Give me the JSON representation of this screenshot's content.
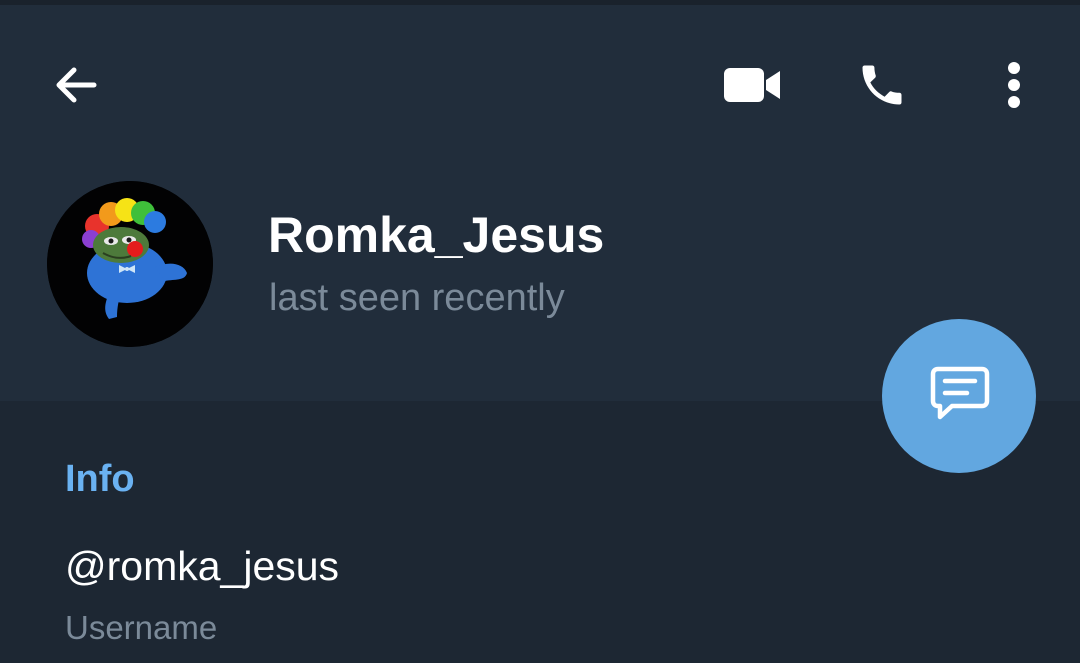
{
  "toolbar": {
    "back_icon": "arrow-left-icon",
    "video_icon": "video-camera-icon",
    "call_icon": "phone-icon",
    "more_icon": "more-vertical-icon"
  },
  "profile": {
    "name": "Romka_Jesus",
    "status": "last seen recently",
    "avatar_icon": "clown-frog-avatar"
  },
  "fab": {
    "icon": "message-bubble-icon"
  },
  "info": {
    "title": "Info",
    "username": "@romka_jesus",
    "username_label": "Username"
  },
  "colors": {
    "header_bg": "#212d3b",
    "body_bg": "#1d2733",
    "accent": "#6ab2f2",
    "fab_bg": "#62a7e0",
    "secondary_text": "#7b8a99"
  }
}
